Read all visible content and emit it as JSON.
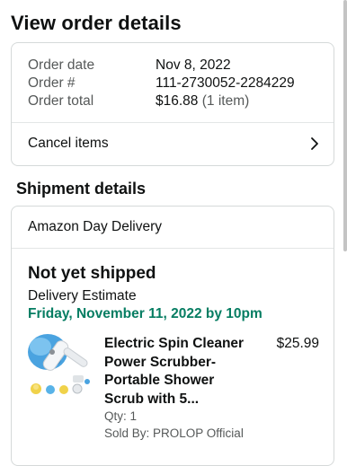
{
  "page": {
    "title": "View order details"
  },
  "summary": {
    "order_date_label": "Order date",
    "order_date_value": "Nov 8, 2022",
    "order_number_label": "Order #",
    "order_number_value": "111-2730052-2284229",
    "order_total_label": "Order total",
    "order_total_value": "$16.88",
    "order_total_note": "(1 item)",
    "cancel_label": "Cancel items",
    "cancel_icon": "chevron-right-icon"
  },
  "shipment": {
    "heading": "Shipment details",
    "delivery_type": "Amazon Day Delivery",
    "status": "Not yet shipped",
    "estimate_label": "Delivery Estimate",
    "estimate_date": "Friday, November 11, 2022 by 10pm",
    "estimate_color": "#067d62",
    "item": {
      "title": "Electric Spin Cleaner Power Scrubber-Portable Shower Scrub with 5...",
      "price": "$25.99",
      "qty": "Qty: 1",
      "seller": "Sold By: PROLOP Official"
    }
  }
}
